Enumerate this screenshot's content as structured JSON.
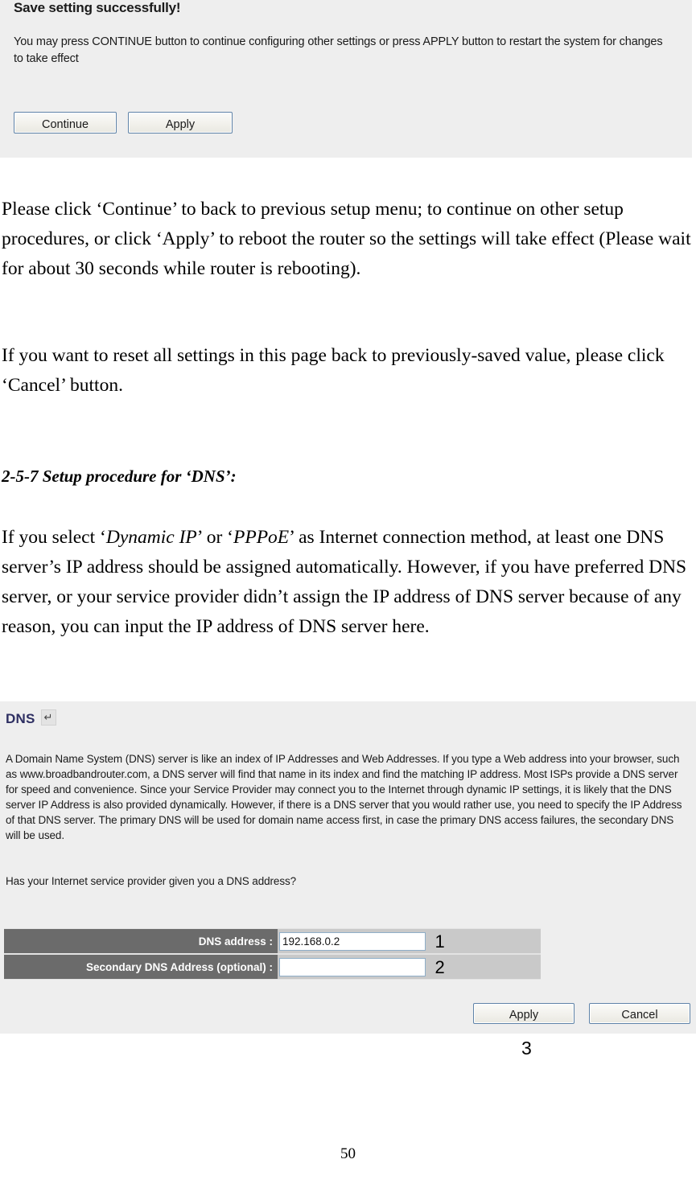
{
  "save_panel": {
    "title": "Save setting successfully!",
    "message": "You may press CONTINUE button to continue configuring other settings or press APPLY button to restart the system for changes to take effect",
    "continue_label": "Continue",
    "apply_label": "Apply"
  },
  "document": {
    "paragraph_1": "Please click ‘Continue’ to back to previous setup menu; to continue on other setup procedures, or click ‘Apply’ to reboot the router so the settings will take effect (Please wait for about 30 seconds while router is rebooting).",
    "paragraph_2": "If you want to reset all settings in this page back to previously-saved value, please click ‘Cancel’ button.",
    "heading_2_5_7": "2-5-7 Setup procedure for ‘DNS’:",
    "paragraph_3_part_1": "If you select ‘",
    "paragraph_3_em_1": "Dynamic IP",
    "paragraph_3_part_2": "’ or ‘",
    "paragraph_3_em_2": "PPPoE",
    "paragraph_3_part_3": "’ as Internet connection method, at least one DNS server’s IP address should be assigned automatically. However, if you have preferred DNS server, or your service provider didn’t assign the IP address of DNS server because of any reason, you can input the IP address of DNS server here.",
    "page_number": "50"
  },
  "dns_panel": {
    "heading": "DNS",
    "heading_icon_glyph": "↵",
    "description": "A Domain Name System (DNS) server is like an index of IP Addresses and Web Addresses. If you type a Web address into your browser, such as www.broadbandrouter.com, a DNS server will find that name in its index and find the matching IP address. Most ISPs provide a DNS server for speed and convenience. Since your Service Provider may connect you to the Internet through dynamic IP settings, it is likely that the DNS server IP Address is also provided dynamically. However, if there is a DNS server that you would rather use, you need to specify the IP Address of that DNS server. The primary DNS will be used for domain name access first, in case the primary DNS access failures, the secondary DNS will be used.",
    "question": "Has your Internet service provider given you a DNS address?",
    "fields": [
      {
        "label": "DNS address :",
        "value": "192.168.0.2",
        "placeholder": "",
        "callout": "1"
      },
      {
        "label": "Secondary DNS Address (optional) :",
        "value": "",
        "placeholder": "",
        "callout": "2"
      }
    ],
    "apply_label": "Apply",
    "cancel_label": "Cancel",
    "buttons_callout": "3"
  },
  "colors": {
    "panel_background": "#eeeeee",
    "label_cell": "#6b6b6b",
    "value_cell": "#c9c9c9",
    "heading_blue": "#2e2f62",
    "button_border": "#5f83a8",
    "input_border": "#8faec8"
  }
}
